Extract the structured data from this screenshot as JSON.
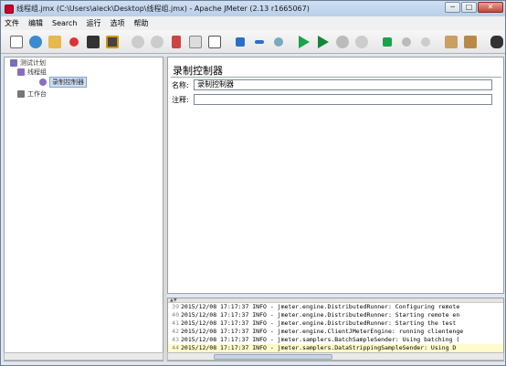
{
  "window": {
    "title": "线程组.jmx (C:\\Users\\aleck\\Desktop\\线程组.jmx) - Apache JMeter (2.13 r1665067)",
    "minimize": "─",
    "maximize": "□",
    "close": "✕"
  },
  "menubar": {
    "items": [
      "文件",
      "编辑",
      "Search",
      "运行",
      "选项",
      "帮助"
    ]
  },
  "toolbar": {
    "buttons": [
      "new",
      "template",
      "open",
      "warning",
      "save",
      "save-as",
      "undo",
      "redo",
      "cut",
      "copy",
      "paste",
      "expand",
      "collapse",
      "toggle",
      "start",
      "start-no-pause",
      "stop",
      "shutdown",
      "remote-start",
      "remote-stop",
      "remote-exit",
      "clear",
      "clear-all",
      "search"
    ]
  },
  "tree": {
    "nodes": [
      {
        "label": "测试计划",
        "color": "#7a6fb5"
      },
      {
        "label": "线程组",
        "color": "#8a6db8"
      },
      {
        "label": "录制控制器",
        "color": "#8d6fbf"
      },
      {
        "label": "工作台",
        "color": "#777777"
      }
    ]
  },
  "panel": {
    "title": "录制控制器",
    "name_label": "名称:",
    "name_value": "录制控制器",
    "comment_label": "注释:",
    "comment_value": ""
  },
  "log": {
    "lines": [
      {
        "num": "39",
        "text": "2015/12/08 17:17:37 INFO  - jmeter.engine.DistributedRunner: Configuring remote"
      },
      {
        "num": "40",
        "text": "2015/12/08 17:17:37 INFO  - jmeter.engine.DistributedRunner: Starting remote en"
      },
      {
        "num": "41",
        "text": "2015/12/08 17:17:37 INFO  - jmeter.engine.DistributedRunner: Starting the test"
      },
      {
        "num": "42",
        "text": "2015/12/08 17:17:37 INFO  - jmeter.engine.ClientJMeterEngine: running clientenge"
      },
      {
        "num": "43",
        "text": "2015/12/08 17:17:37 INFO  - jmeter.samplers.BatchSampleSender: Using batching ("
      },
      {
        "num": "44",
        "text": "2015/12/08 17:17:37 INFO  - jmeter.samplers.DataStrippingSampleSender: Using D"
      }
    ]
  }
}
